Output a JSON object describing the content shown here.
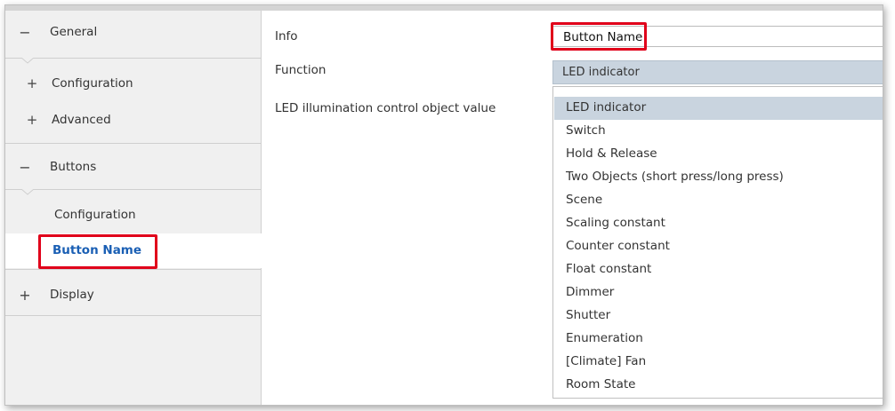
{
  "sidebar": {
    "general": {
      "label": "General",
      "symbol": "−"
    },
    "configuration": {
      "label": "Configuration",
      "symbol": "+"
    },
    "advanced": {
      "label": "Advanced",
      "symbol": "+"
    },
    "buttons": {
      "label": "Buttons",
      "symbol": "−"
    },
    "buttons_configuration": {
      "label": "Configuration"
    },
    "button_name": {
      "label": "Button Name"
    },
    "display": {
      "label": "Display",
      "symbol": "+"
    }
  },
  "main": {
    "info_label": "Info",
    "info_value": "Button Name",
    "function_label": "Function",
    "function_value": "LED indicator",
    "led_label": "LED illumination control object value",
    "options": [
      "LED indicator",
      "Switch",
      "Hold & Release",
      "Two Objects (short press/long press)",
      "Scene",
      "Scaling constant",
      "Counter constant",
      "Float constant",
      "Dimmer",
      "Shutter",
      "Enumeration",
      "[Climate] Fan",
      "Room State"
    ],
    "selected_option": "LED indicator",
    "check_glyph": "✔"
  },
  "colors": {
    "highlight": "#e0001a",
    "selected_text": "#1a5fb4",
    "selected_row": "#c9d4df"
  }
}
